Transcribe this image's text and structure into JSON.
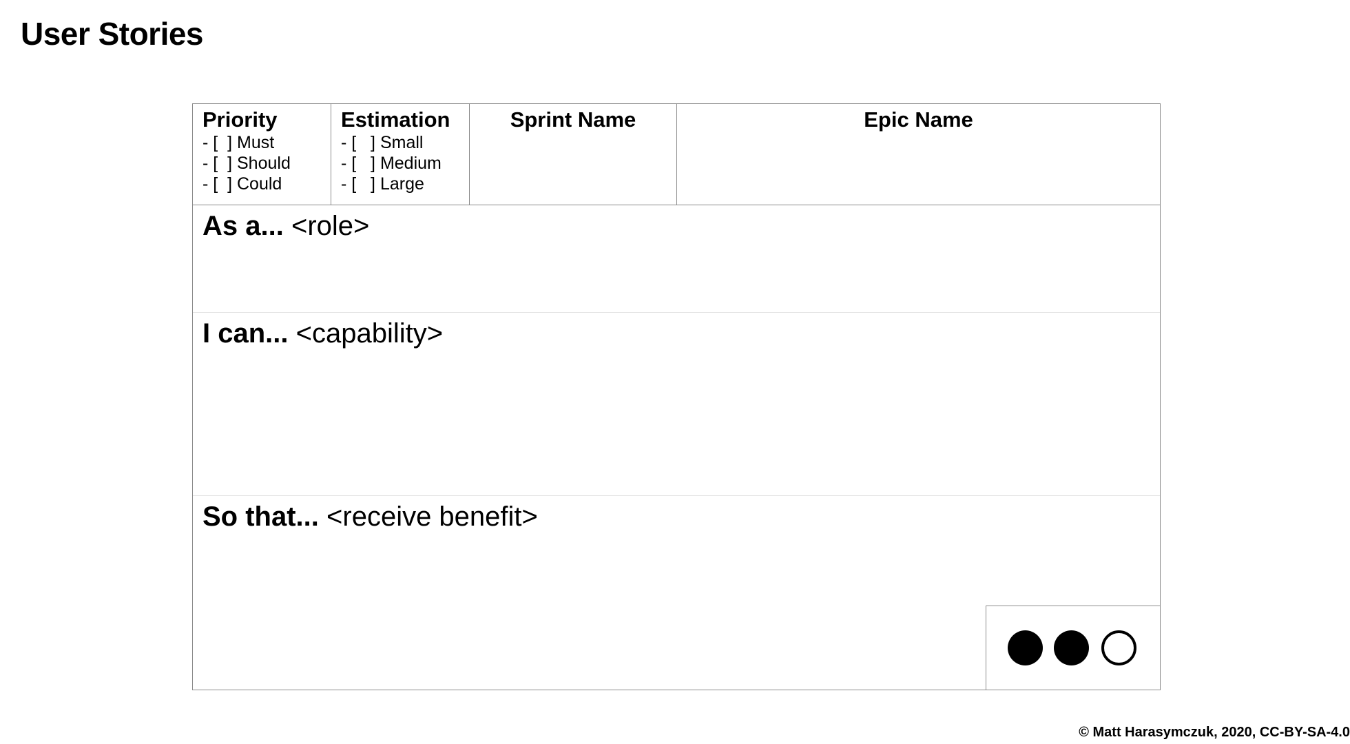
{
  "page": {
    "title": "User Stories"
  },
  "card": {
    "priority": {
      "title": "Priority",
      "options": [
        "- [  ] Must",
        "- [  ] Should",
        "- [  ] Could"
      ]
    },
    "estimation": {
      "title": "Estimation",
      "options": [
        "- [   ] Small",
        "- [   ] Medium",
        "- [   ] Large"
      ]
    },
    "sprint": {
      "title": "Sprint Name"
    },
    "epic": {
      "title": "Epic Name"
    },
    "role": {
      "prefix": "As a...",
      "placeholder": "<role>"
    },
    "capability": {
      "prefix": "I can...",
      "placeholder": "<capability>"
    },
    "benefit": {
      "prefix": "So that...",
      "placeholder": "<receive benefit>"
    },
    "dots": {
      "states": [
        "filled",
        "filled",
        "empty"
      ],
      "filled_count": 2,
      "total": 3
    }
  },
  "footer": {
    "copyright": "© Matt Harasymczuk, 2020, CC-BY-SA-4.0"
  }
}
